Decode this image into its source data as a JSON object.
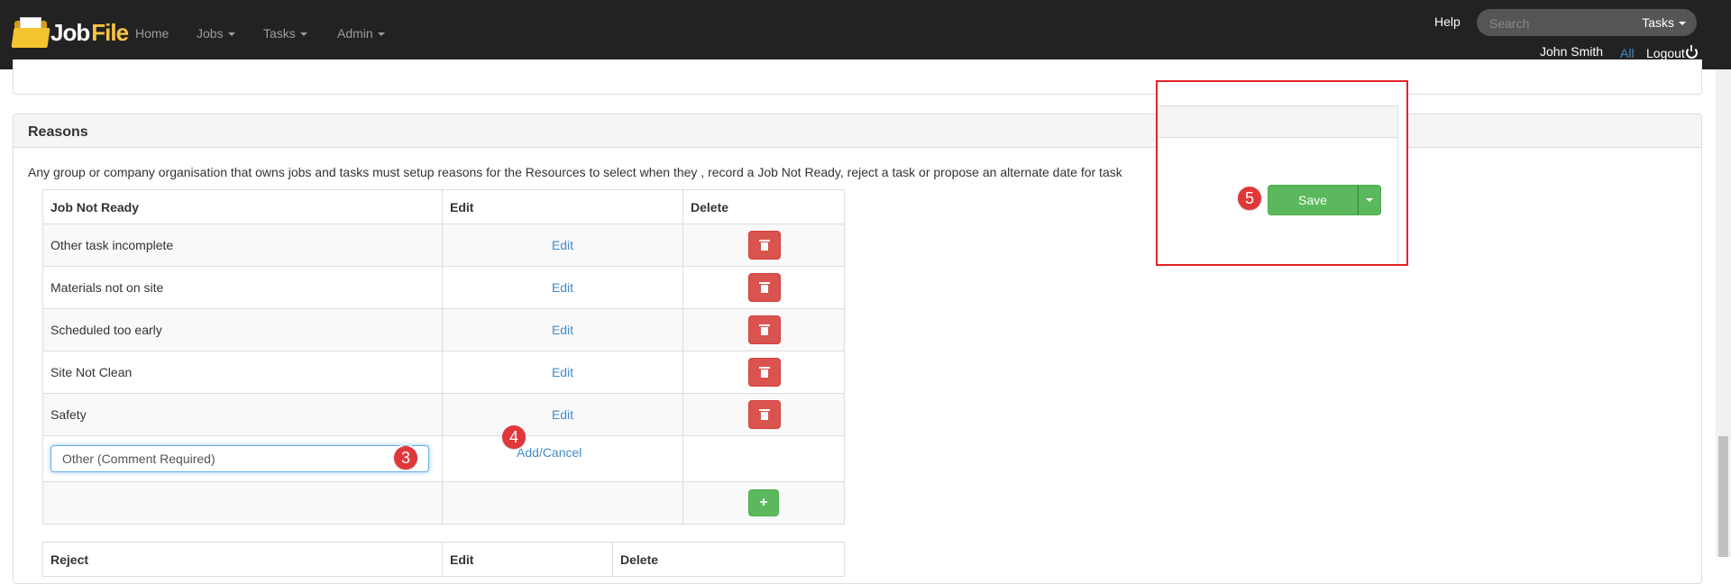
{
  "app": {
    "brand_part1": "Job",
    "brand_part2": "File"
  },
  "nav": {
    "home": "Home",
    "jobs": "Jobs",
    "tasks": "Tasks",
    "admin": "Admin",
    "help": "Help",
    "search_placeholder": "Search",
    "search_scope": "Tasks",
    "user": "John Smith",
    "all": "All",
    "logout": "Logout"
  },
  "reasons": {
    "title": "Reasons",
    "description": "Any group or company organisation that owns jobs and tasks must setup reasons for the Resources to select when they , record a Job Not Ready, reject a task or propose an alternate date for task",
    "table": {
      "headers": [
        "Job Not Ready",
        "Edit",
        "Delete"
      ],
      "edit_label": "Edit",
      "rows": [
        "Other task incomplete",
        "Materials not on site",
        "Scheduled too early",
        "Site Not Clean",
        "Safety"
      ],
      "new_value": "Other (Comment Required)",
      "add_label": "Add",
      "separator": "/",
      "cancel_label": "Cancel",
      "add_button": "+"
    },
    "second_table_headers": [
      "Reject",
      "Edit",
      "Delete"
    ]
  },
  "callouts": {
    "step3": "3",
    "step4": "4",
    "step5": "5"
  },
  "save": {
    "label": "Save"
  },
  "colors": {
    "navbar": "#222222",
    "link": "#428bca",
    "danger": "#d9534f",
    "success": "#5cb85c",
    "callout_border": "#e32227"
  },
  "icons": [
    "trash-icon",
    "plus-icon",
    "power-icon",
    "caret-down-icon",
    "jobfile-logo"
  ]
}
